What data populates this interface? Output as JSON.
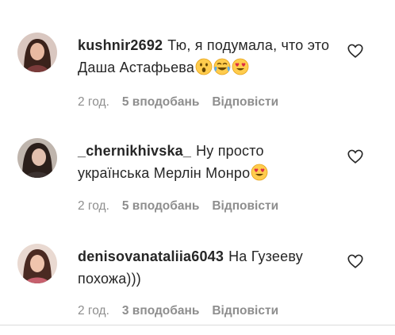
{
  "comments": [
    {
      "username": "kushnir2692",
      "text": "Тю, я подумала, что это Даша Астафьева",
      "emojis": [
        "astonished-face",
        "tears-of-joy-face",
        "heart-eyes-face"
      ],
      "time": "2 год.",
      "likes": "5 вподобань",
      "reply": "Відповісти"
    },
    {
      "username": "_chernikhivska_",
      "text": "Ну просто українська Мерлін Монро",
      "emojis": [
        "heart-eyes-face"
      ],
      "time": "2 год.",
      "likes": "5 вподобань",
      "reply": "Відповісти"
    },
    {
      "username": "denisovanataliia6043",
      "text": "На Гузееву похожа)))",
      "emojis": [],
      "time": "2 год.",
      "likes": "3 вподобань",
      "reply": "Відповісти"
    }
  ],
  "colors": {
    "text": "#262626",
    "secondary": "#8e8e8e",
    "divider": "#dbdbdb",
    "emoji_yellow": "#ffcc4d"
  }
}
